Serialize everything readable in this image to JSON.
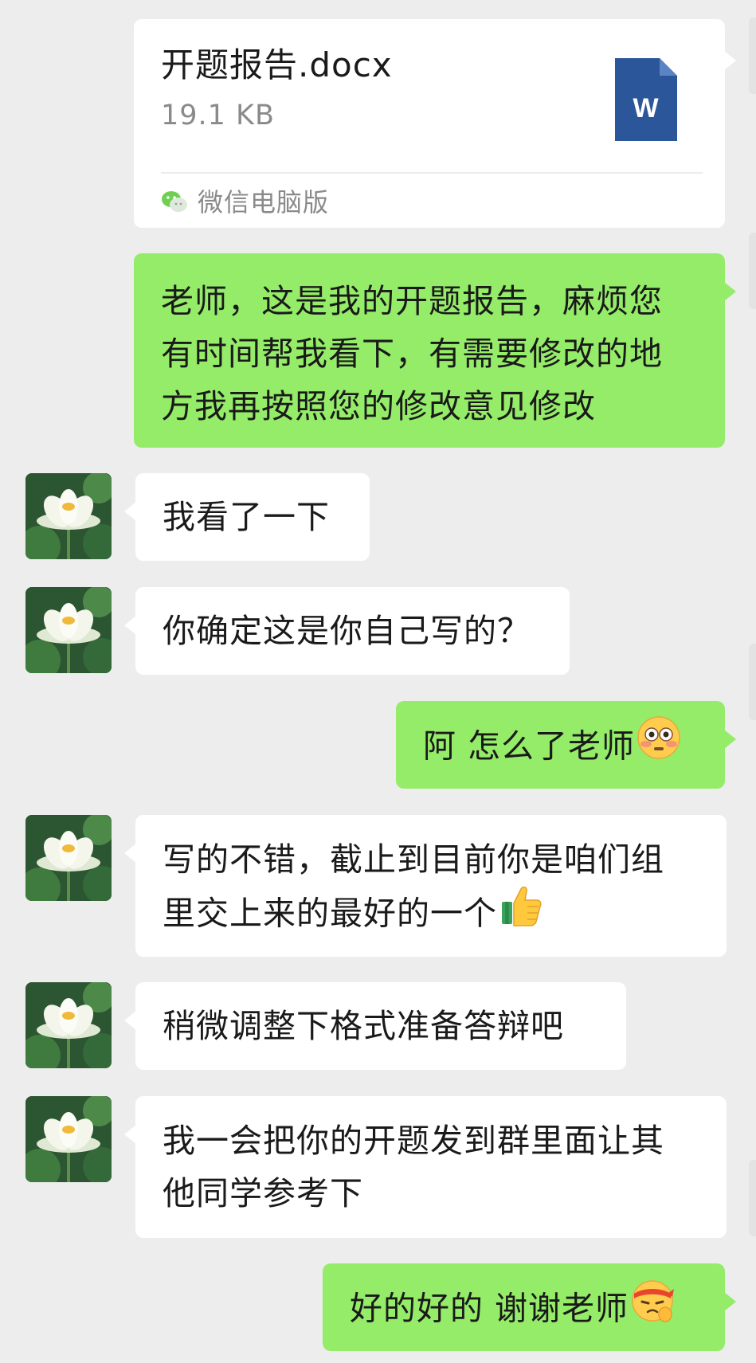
{
  "file_message": {
    "file_name": "开题报告.docx",
    "file_size": "19.1 KB",
    "file_type_letter": "W",
    "source_label": "微信电脑版",
    "file_icon": "word-document-icon",
    "source_icon": "wechat-logo-icon"
  },
  "messages": [
    {
      "sender": "me",
      "text": "老师，这是我的开题报告，麻烦您\n有时间帮我看下，有需要修改的地\n方我再按照您的修改意见修改"
    },
    {
      "sender": "teacher",
      "text": "我看了一下"
    },
    {
      "sender": "teacher",
      "text": "你确定这是你自己写的？"
    },
    {
      "sender": "me",
      "text": "阿 怎么了老师",
      "emoji": "flushed-face-emoji"
    },
    {
      "sender": "teacher",
      "text": "写的不错，截止到目前你是咱们组\n里交上来的最好的一个",
      "emoji": "thumbs-up-emoji"
    },
    {
      "sender": "teacher",
      "text": "稍微调整下格式准备答辩吧"
    },
    {
      "sender": "teacher",
      "text": "我一会把你的开题发到群里面让其\n他同学参考下"
    },
    {
      "sender": "me",
      "text": "好的好的 谢谢老师",
      "emoji": "saluting-headband-face-emoji"
    }
  ],
  "avatar_icon": "lotus-flower-avatar",
  "colors": {
    "background": "#ededed",
    "sent_bubble": "#95ec69",
    "received_bubble": "#ffffff",
    "word_blue": "#2b579a"
  }
}
